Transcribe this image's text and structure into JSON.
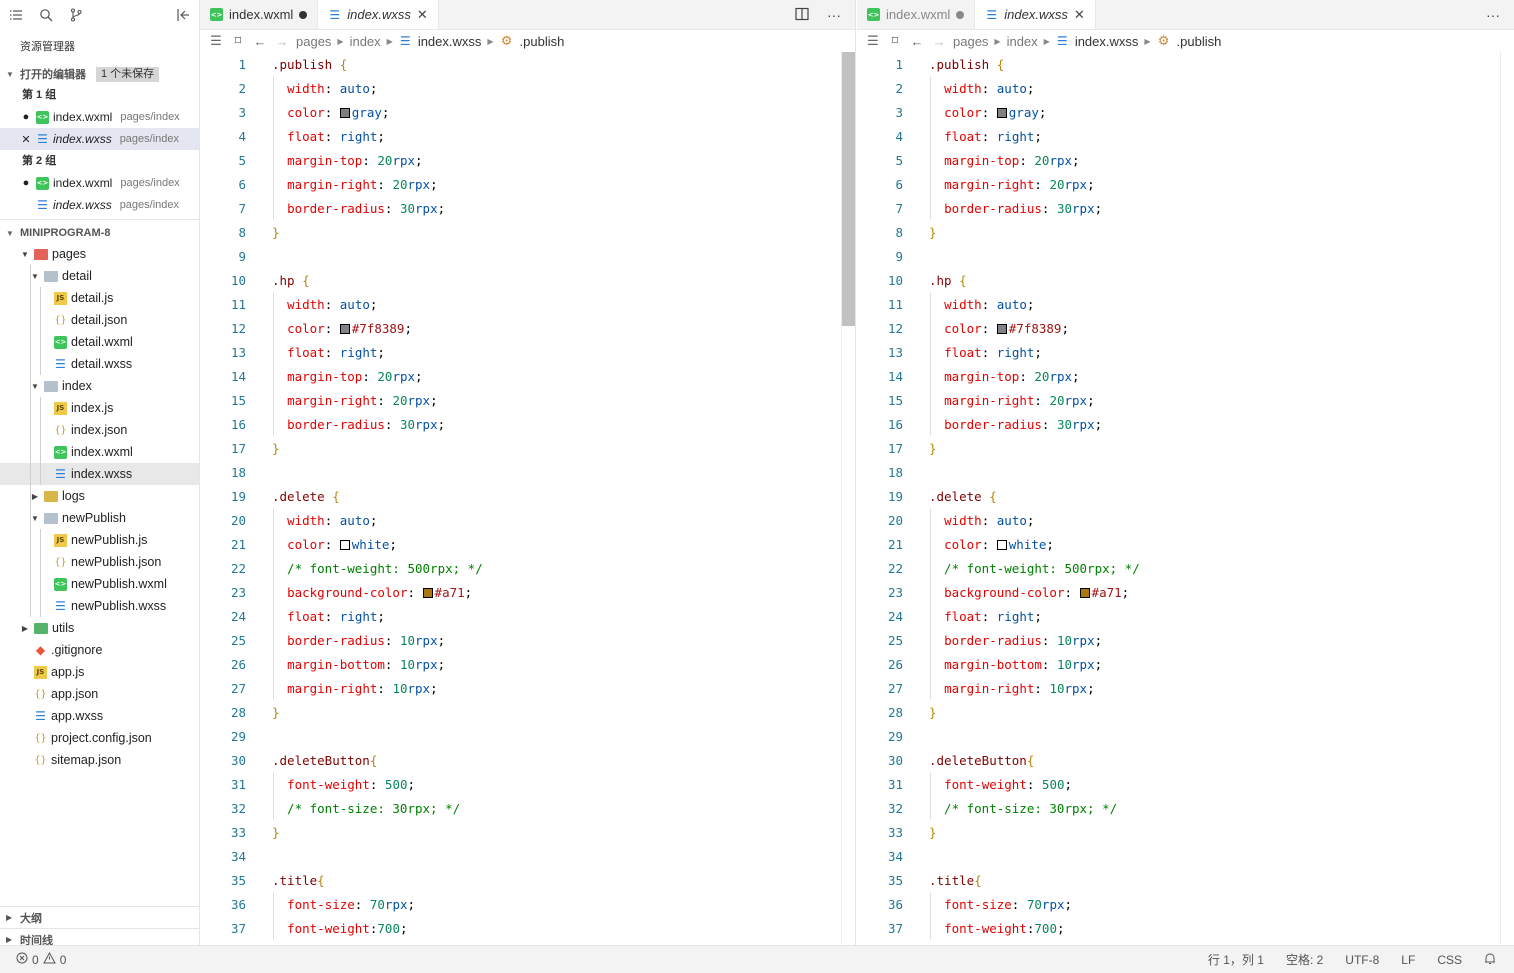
{
  "sidebar": {
    "title": "资源管理器",
    "open_editors": {
      "label": "打开的编辑器",
      "badge": "1 个未保存",
      "groups": [
        {
          "label": "第 1 组",
          "items": [
            {
              "mark": "●",
              "name": "index.wxml",
              "path": "pages/index",
              "icon": "wxml",
              "italic": false,
              "selected": false
            },
            {
              "mark": "✕",
              "name": "index.wxss",
              "path": "pages/index",
              "icon": "wxss",
              "italic": true,
              "selected": true
            }
          ]
        },
        {
          "label": "第 2 组",
          "items": [
            {
              "mark": "●",
              "name": "index.wxml",
              "path": "pages/index",
              "icon": "wxml",
              "italic": false,
              "selected": false
            },
            {
              "mark": "",
              "name": "index.wxss",
              "path": "pages/index",
              "icon": "wxss",
              "italic": true,
              "selected": false
            }
          ]
        }
      ]
    },
    "project": {
      "label": "MINIPROGRAM-8",
      "tree": [
        {
          "name": "pages",
          "type": "folder-red",
          "depth": 0,
          "caret": "open"
        },
        {
          "name": "detail",
          "type": "folder",
          "depth": 1,
          "caret": "open"
        },
        {
          "name": "detail.js",
          "type": "js",
          "depth": 2
        },
        {
          "name": "detail.json",
          "type": "json",
          "depth": 2
        },
        {
          "name": "detail.wxml",
          "type": "wxml",
          "depth": 2
        },
        {
          "name": "detail.wxss",
          "type": "wxss",
          "depth": 2
        },
        {
          "name": "index",
          "type": "folder",
          "depth": 1,
          "caret": "open"
        },
        {
          "name": "index.js",
          "type": "js",
          "depth": 2
        },
        {
          "name": "index.json",
          "type": "json",
          "depth": 2
        },
        {
          "name": "index.wxml",
          "type": "wxml",
          "depth": 2
        },
        {
          "name": "index.wxss",
          "type": "wxss",
          "depth": 2,
          "selected": true
        },
        {
          "name": "logs",
          "type": "folder-yellow",
          "depth": 1,
          "caret": "closed"
        },
        {
          "name": "newPublish",
          "type": "folder",
          "depth": 1,
          "caret": "open"
        },
        {
          "name": "newPublish.js",
          "type": "js",
          "depth": 2
        },
        {
          "name": "newPublish.json",
          "type": "json",
          "depth": 2
        },
        {
          "name": "newPublish.wxml",
          "type": "wxml",
          "depth": 2
        },
        {
          "name": "newPublish.wxss",
          "type": "wxss",
          "depth": 2
        },
        {
          "name": "utils",
          "type": "folder-green",
          "depth": 0,
          "caret": "closed"
        },
        {
          "name": ".gitignore",
          "type": "git",
          "depth": 0
        },
        {
          "name": "app.js",
          "type": "js",
          "depth": 0
        },
        {
          "name": "app.json",
          "type": "json",
          "depth": 0
        },
        {
          "name": "app.wxss",
          "type": "wxss",
          "depth": 0
        },
        {
          "name": "project.config.json",
          "type": "json",
          "depth": 0
        },
        {
          "name": "sitemap.json",
          "type": "json",
          "depth": 0
        }
      ]
    },
    "outline_label": "大纲",
    "timeline_label": "时间线",
    "toolbar_icons": [
      "list-icon",
      "search-icon",
      "source-control-icon",
      "collapse-panel-icon"
    ]
  },
  "editors": [
    {
      "tabs": [
        {
          "name": "index.wxml",
          "icon": "wxml",
          "state": "dirty",
          "active": false,
          "italic": false
        },
        {
          "name": "index.wxss",
          "icon": "wxss",
          "state": "close",
          "active": true,
          "italic": true
        }
      ],
      "breadcrumbs": [
        "pages",
        "index",
        "index.wxss",
        ".publish"
      ]
    },
    {
      "tabs": [
        {
          "name": "index.wxml",
          "icon": "wxml",
          "state": "dirty",
          "active": false,
          "italic": false,
          "dim": true
        },
        {
          "name": "index.wxss",
          "icon": "wxss",
          "state": "close",
          "active": true,
          "italic": true
        }
      ],
      "breadcrumbs": [
        "pages",
        "index",
        "index.wxss",
        ".publish"
      ]
    }
  ],
  "code_lines": [
    ".publish {",
    "  width: auto;",
    "  color: gray;",
    "  float: right;",
    "  margin-top: 20rpx;",
    "  margin-right: 20rpx;",
    "  border-radius: 30rpx;",
    "}",
    "",
    ".hp {",
    "  width: auto;",
    "  color: #7f8389;",
    "  float: right;",
    "  margin-top: 20rpx;",
    "  margin-right: 20rpx;",
    "  border-radius: 30rpx;",
    "}",
    "",
    ".delete {",
    "  width: auto;",
    "  color: white;",
    "  /* font-weight: 500rpx; */",
    "  background-color: #a71;",
    "  float: right;",
    "  border-radius: 10rpx;",
    "  margin-bottom: 10rpx;",
    "  margin-right: 10rpx;",
    "}",
    "",
    ".deleteButton{",
    "  font-weight: 500;",
    "  /* font-size: 30rpx; */",
    "}",
    "",
    ".title{",
    "  font-size: 70rpx;",
    "  font-weight:700;"
  ],
  "swatch_colors": {
    "gray": "#808080",
    "#7f8389": "#7f8389",
    "white": "#ffffff",
    "#a71": "#aa7711"
  },
  "statusbar": {
    "errors": "0",
    "warnings": "0",
    "position": "行 1，列 1",
    "spaces": "空格: 2",
    "encoding": "UTF-8",
    "eol": "LF",
    "language": "CSS"
  }
}
